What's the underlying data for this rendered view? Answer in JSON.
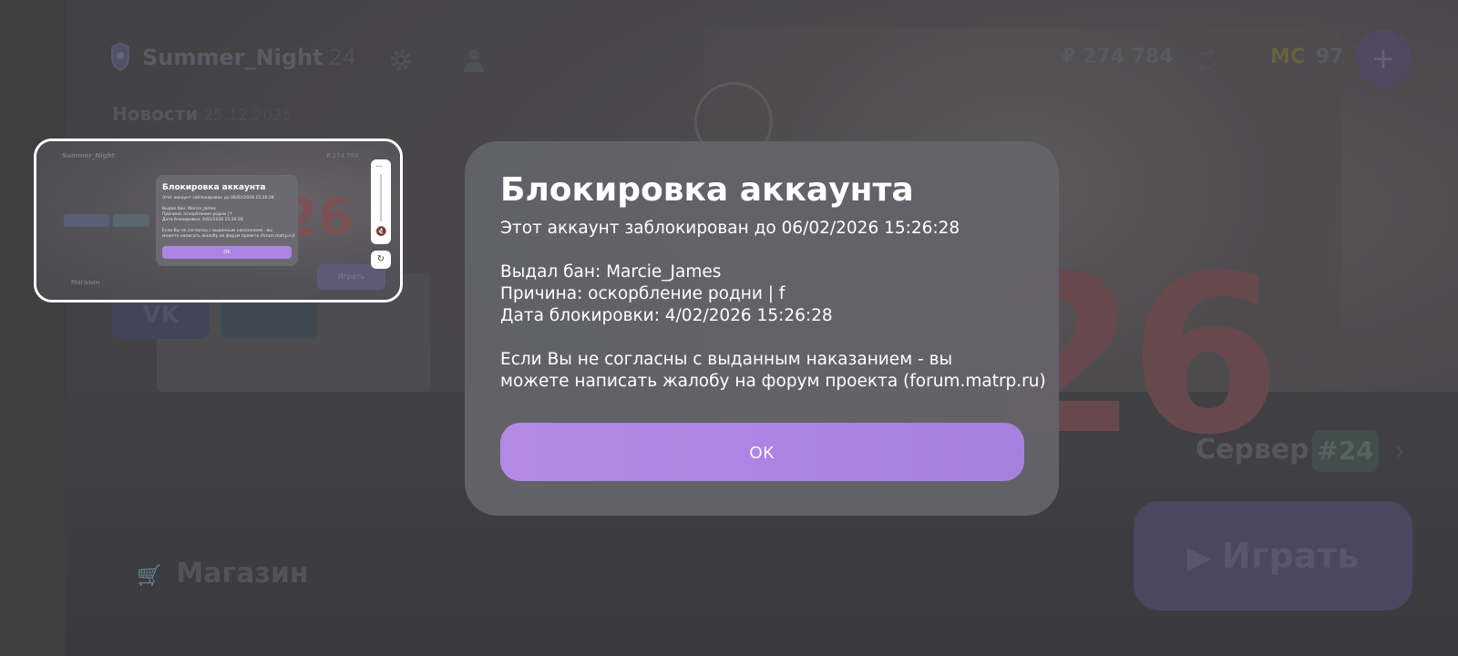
{
  "header": {
    "server_name": "Summer_Night",
    "server_number": "24",
    "balance": "₽ 274 784",
    "mc_label": "MC",
    "mc_value": "97",
    "plus_label": "+"
  },
  "news": {
    "label": "Новости",
    "date": "25.12.2025"
  },
  "social": {
    "vk_label": "VK"
  },
  "shop": {
    "label": "Магазин"
  },
  "server_select": {
    "label": "Сервер",
    "badge": "#24"
  },
  "play": {
    "label": "Играть"
  },
  "dialog": {
    "title": "Блокировка аккаунта",
    "blocked_until": "Этот аккаунт заблокирован до 06/02/2026 15:26:28",
    "issued_by": "Выдал бан: Marcie_James",
    "reason": "Причина: оскорбление родни | f",
    "block_date": "Дата блокировки: 4/02/2026 15:26:28",
    "appeal_line1": "Если Вы не согласны с выданным наказанием - вы",
    "appeal_line2": "можете написать жалобу на форум проекта (forum.matrp.ru)",
    "ok_label": "OK"
  },
  "thumbnail": {
    "server_name": "Summer_Night",
    "top_right": "₽ 274 784",
    "title": "Блокировка аккаунта",
    "line1": "Этот аккаунт заблокирован до 06/02/2026 15:26:28",
    "line2": "Выдал бан: Marcie_James",
    "line3": "Причина: оскорбление родни | f",
    "line4": "Дата блокировки: 4/02/2026 15:26:28",
    "line5": "Если Вы не согласны с выданным наказанием - вы",
    "line6": "можете написать жалобу на форум проекта (forum.matrp.ru)",
    "ok_label": "OK",
    "shop_label": "Магазин",
    "play_label": "Играть",
    "number": "26"
  },
  "background": {
    "number": "26"
  },
  "icons": {
    "logo": "shield-logo-icon",
    "settings": "gear-icon",
    "profile": "person-icon",
    "sync": "sync-icon",
    "cart": "cart-icon",
    "play": "play-icon",
    "chevron": "chevron-right-icon",
    "more": "more-dots-icon",
    "mute": "mute-icon",
    "rotate": "rotate-icon"
  },
  "colors": {
    "accent": "#b08ae4",
    "dialog_bg": "#646469",
    "text": "#ffffff"
  }
}
